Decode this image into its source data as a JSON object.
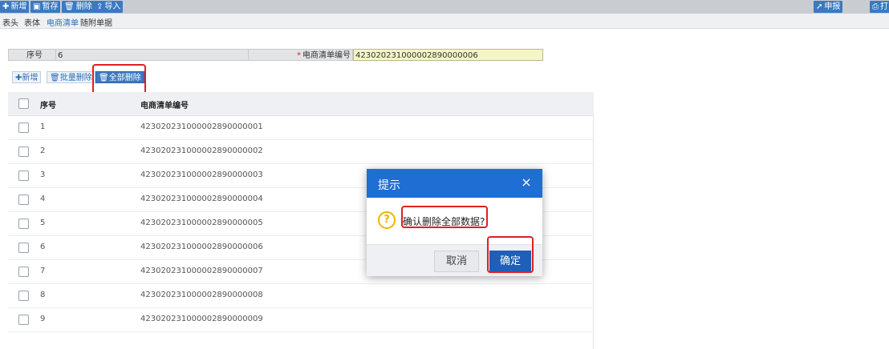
{
  "toolbar": {
    "buttons": [
      {
        "icon": "plus-icon",
        "glyph": "✚",
        "label": "新增"
      },
      {
        "icon": "save-icon",
        "glyph": "▣",
        "label": "暂存"
      },
      {
        "icon": "trash-icon",
        "glyph": "🗑",
        "label": "删除"
      },
      {
        "icon": "import-icon",
        "glyph": "⇪",
        "label": "导入"
      }
    ],
    "right_buttons": [
      {
        "icon": "send-icon",
        "glyph": "➚",
        "label": "申报"
      },
      {
        "icon": "print-icon",
        "glyph": "⎙",
        "label": "打"
      }
    ]
  },
  "tabs": [
    "表头",
    "表体",
    "电商清单",
    "随附单据"
  ],
  "active_tab": "电商清单",
  "form": {
    "seq_label": "序号",
    "seq_value": "6",
    "required_mark": "*",
    "ec_label": "电商清单编号",
    "ec_value": "423020231000002890000006"
  },
  "subtoolbar": {
    "add": {
      "glyph": "✚",
      "label": "新增"
    },
    "batch_delete": {
      "glyph": "🗑",
      "label": "批量删除"
    },
    "delete_all": {
      "glyph": "🗑",
      "label": "全部删除"
    }
  },
  "grid": {
    "headers": {
      "seq": "序号",
      "no": "电商清单编号"
    },
    "rows": [
      {
        "seq": "1",
        "no": "423020231000002890000001"
      },
      {
        "seq": "2",
        "no": "423020231000002890000002"
      },
      {
        "seq": "3",
        "no": "423020231000002890000003"
      },
      {
        "seq": "4",
        "no": "423020231000002890000004"
      },
      {
        "seq": "5",
        "no": "423020231000002890000005"
      },
      {
        "seq": "6",
        "no": "423020231000002890000006"
      },
      {
        "seq": "7",
        "no": "423020231000002890000007"
      },
      {
        "seq": "8",
        "no": "423020231000002890000008"
      },
      {
        "seq": "9",
        "no": "423020231000002890000009"
      }
    ]
  },
  "modal": {
    "title": "提示",
    "close": "×",
    "icon": "question-icon",
    "icon_glyph": "?",
    "message": "确认删除全部数据?",
    "cancel": "取消",
    "ok": "确定"
  },
  "colors": {
    "toolbar_button": "#3b79c2",
    "modal_header": "#1f6ed4",
    "highlight": "#e02020",
    "ok_button": "#1f5fb8"
  }
}
